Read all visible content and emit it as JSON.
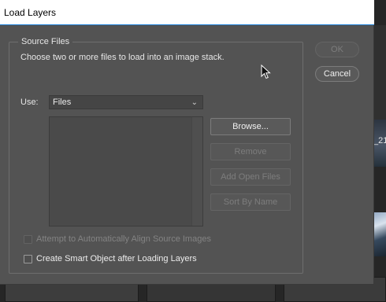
{
  "background": {
    "right_label": "_214"
  },
  "dialog": {
    "title": "Load Layers",
    "group": {
      "legend": "Source Files",
      "instructions": "Choose two or more files to load into an image stack.",
      "use_label": "Use:",
      "use_value": "Files",
      "file_list": []
    },
    "buttons": {
      "browse": "Browse...",
      "remove": "Remove",
      "add_open_files": "Add Open Files",
      "sort_by_name": "Sort By Name",
      "ok": "OK",
      "cancel": "Cancel"
    },
    "checkboxes": {
      "align": {
        "label": "Attempt to Automatically Align Source Images",
        "checked": false,
        "enabled": false
      },
      "smart_object": {
        "label": "Create Smart Object after Loading Layers",
        "checked": false,
        "enabled": true
      }
    }
  },
  "colors": {
    "dialog_bg": "#535353",
    "titlebar_bg": "#ffffff",
    "text": "#e6e6e6",
    "disabled_text": "#7d7d7d"
  }
}
